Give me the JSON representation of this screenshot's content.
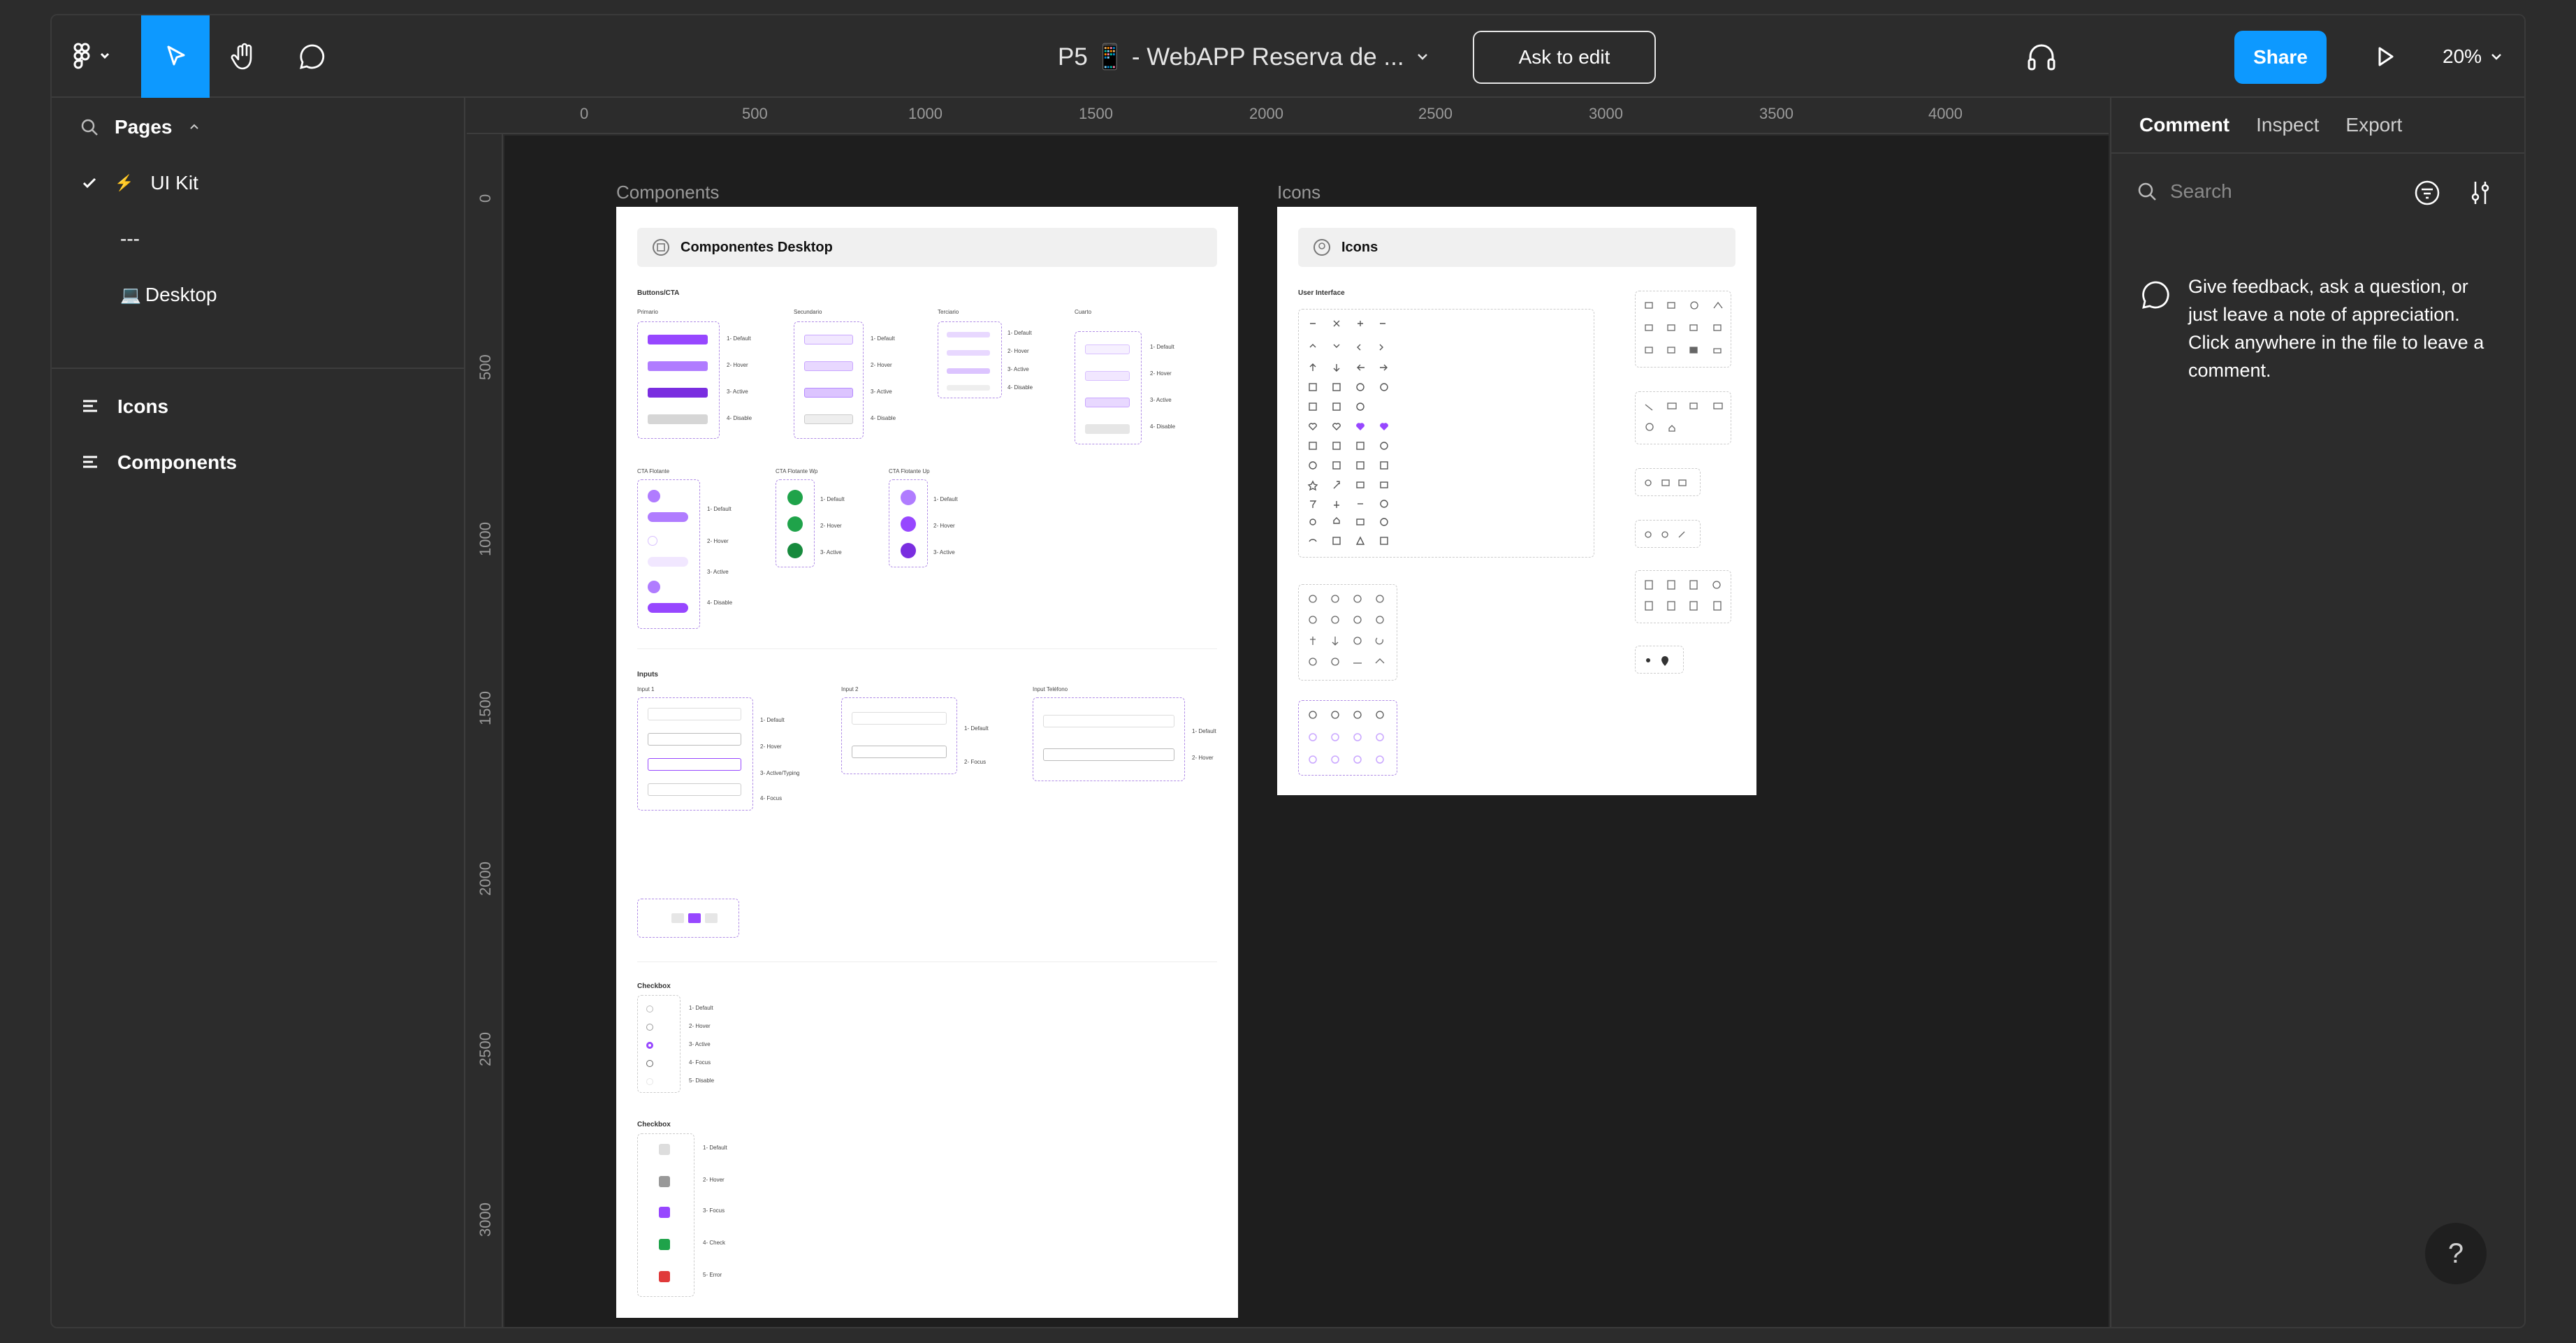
{
  "toolbar": {
    "title": "P5 📱 - WebAPP Reserva de ...",
    "ask_to_edit": "Ask to edit",
    "share": "Share",
    "zoom": "20%"
  },
  "left_panel": {
    "pages_label": "Pages",
    "pages": [
      {
        "label": "UI Kit",
        "prefix": "⚡"
      },
      {
        "label": "---",
        "prefix": ""
      },
      {
        "label": "Desktop",
        "prefix": "💻"
      }
    ],
    "layers": [
      {
        "label": "Icons"
      },
      {
        "label": "Components"
      }
    ]
  },
  "ruler": {
    "top": [
      "0",
      "500",
      "1000",
      "1500",
      "2000",
      "2500",
      "3000",
      "3500",
      "4000"
    ],
    "left": [
      "0",
      "500",
      "1000",
      "1500",
      "2000",
      "2500",
      "3000"
    ]
  },
  "canvas": {
    "components_label": "Components",
    "icons_label": "Icons",
    "components_frame": {
      "header": "Componentes Desktop",
      "buttons_title": "Buttons/CTA",
      "col_labels": [
        "Primario",
        "Secundario",
        "Terciario",
        "Cuarto"
      ],
      "states4": [
        "1- Default",
        "2- Hover",
        "3- Active",
        "4- Disable"
      ],
      "cta_labels": [
        "CTA Flotante",
        "CTA Flotante Wp",
        "CTA Flotante Up"
      ],
      "states3": [
        "1- Default",
        "2- Hover",
        "3- Active"
      ],
      "inputs_title": "Inputs",
      "input_labels": [
        "Input 1",
        "Input 2",
        "Input Teléfono"
      ],
      "input_states": [
        "1- Default",
        "2- Hover",
        "3- Active/Typing",
        "4- Focus"
      ],
      "input2_states": [
        "1- Default",
        "2- Focus"
      ],
      "input3_states": [
        "1- Default",
        "2- Hover"
      ],
      "checkbox_title": "Checkbox",
      "checkbox_states": [
        "1- Default",
        "2- Hover",
        "3- Active",
        "4- Focus",
        "5- Disable"
      ],
      "checkbox2_title": "Checkbox",
      "checkbox2_states": [
        "1- Default",
        "2- Hover",
        "3- Focus",
        "4- Check",
        "5- Error"
      ]
    },
    "icons_frame": {
      "header": "Icons",
      "section": "User Interface"
    }
  },
  "right_panel": {
    "tabs": [
      "Comment",
      "Inspect",
      "Export"
    ],
    "search_placeholder": "Search",
    "hint": "Give feedback, ask a question, or just leave a note of appreciation. Click anywhere in the file to leave a comment."
  },
  "help": "?",
  "colors": {
    "accent": "#0d99ff",
    "purple": "#9747ff",
    "green": "#1fa34a"
  }
}
